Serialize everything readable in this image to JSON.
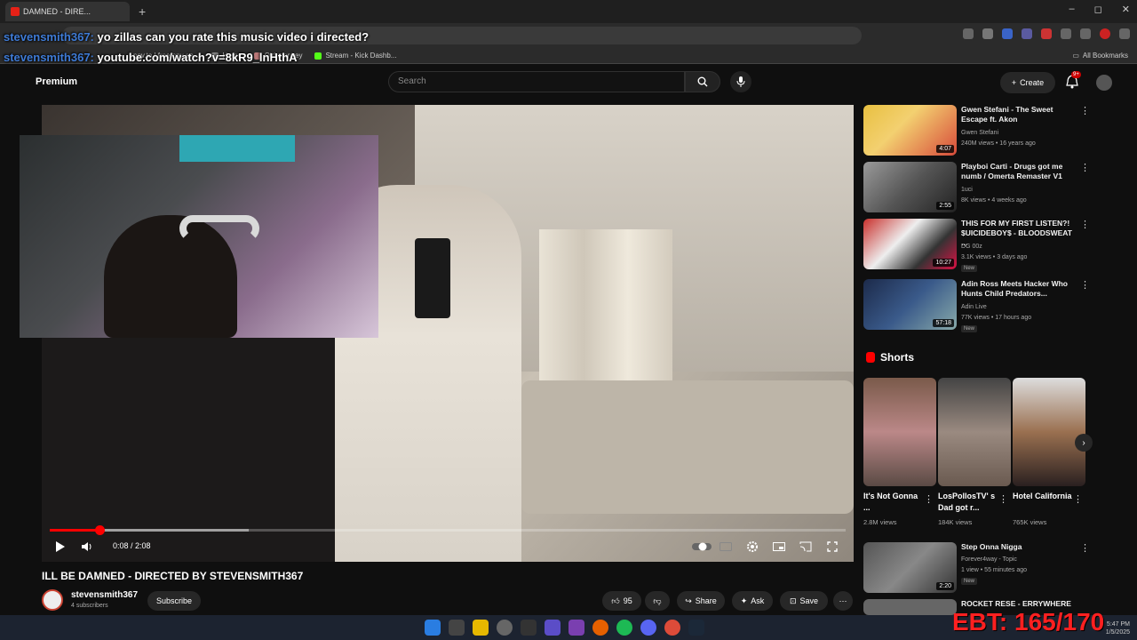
{
  "browser": {
    "tab_title": "DAMNED - DIRE...",
    "new_tab": "+",
    "window_controls": [
      "–",
      "◻",
      "✕"
    ],
    "bookmarks": [
      {
        "label": "ppv.to | free ppv an..."
      },
      {
        "label": "Home"
      },
      {
        "label": "Old monkey"
      },
      {
        "label": "Stream - Kick Dashb..."
      }
    ],
    "all_bookmarks": "All Bookmarks"
  },
  "chat": [
    {
      "user": "stevensmith367:",
      "message": "yo zillas can you rate this music video i directed?"
    },
    {
      "user": "stevensmith367:",
      "message": "youtube.com/watch?v=8kR9_lnHthA"
    }
  ],
  "youtube": {
    "logo": "Premium",
    "search_placeholder": "Search",
    "create_label": "Create",
    "notification_count": "9+"
  },
  "player": {
    "time": "0:08 / 2:08",
    "progress_fraction": 0.0625,
    "buffer_fraction": 0.25
  },
  "video": {
    "title": "ILL BE DAMNED - DIRECTED BY STEVENSMITH367",
    "channel": "stevensmith367",
    "subscribers": "4 subscribers",
    "subscribe_label": "Subscribe",
    "likes": "95",
    "share_label": "Share",
    "ask_label": "Ask",
    "save_label": "Save"
  },
  "recommendations": [
    {
      "title": "Gwen Stefani - The Sweet Escape ft. Akon",
      "channel": "Gwen Stefani",
      "meta": "240M views • 16 years ago",
      "duration": "4:07",
      "new": ""
    },
    {
      "title": "Playboi Carti - Drugs got me numb / Omerta Remaster V1",
      "channel": "1uci",
      "meta": "8K views • 4 weeks ago",
      "duration": "2:55",
      "new": ""
    },
    {
      "title": "THIS FOR MY FIRST LISTEN?! $UICIDEBOY$ - BLOODSWEAT ...",
      "channel": "DG 00z",
      "meta": "3.1K views • 3 days ago",
      "duration": "10:27",
      "new": "New"
    },
    {
      "title": "Adin Ross Meets Hacker Who Hunts Child Predators...",
      "channel": "Adin Live",
      "meta": "77K views • 17 hours ago",
      "duration": "57:18",
      "new": "New"
    }
  ],
  "shorts": {
    "heading": "Shorts",
    "items": [
      {
        "title": "It's Not Gonna ...",
        "views": "2.8M views"
      },
      {
        "title": "LosPollosTV' s Dad got r...",
        "views": "184K views"
      },
      {
        "title": "Hotel California",
        "views": "765K views"
      }
    ]
  },
  "rec_after": {
    "title": "Step Onna Nigga",
    "channel": "Forever4way - Topic",
    "meta": "1 view • 55 minutes ago",
    "duration": "2:20",
    "new": "New"
  },
  "rec_last": {
    "title": "ROCKET RESE - ERRYWHERE"
  },
  "overlay": {
    "ebt": "EBT: 165/170"
  },
  "taskbar": {
    "clock_time": "5:47 PM",
    "clock_date": "1/5/2025"
  },
  "colors": {
    "brand_red": "#ff0000",
    "chat_user": "#3e7bd6",
    "ebt_red": "#ff2020"
  }
}
